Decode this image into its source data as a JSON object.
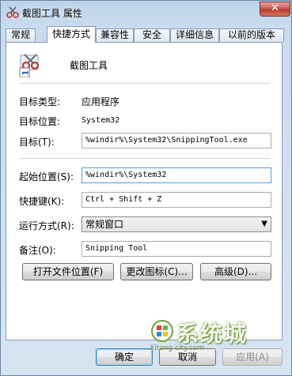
{
  "window": {
    "title": "截图工具 属性",
    "close_glyph": "✕"
  },
  "tabs": [
    "常规",
    "快捷方式",
    "兼容性",
    "安全",
    "详细信息",
    "以前的版本"
  ],
  "active_tab": "快捷方式",
  "app": {
    "name": "截图工具",
    "icon": "scissors-icon"
  },
  "fields": {
    "target_type": {
      "label": "目标类型:",
      "value": "应用程序"
    },
    "target_location": {
      "label": "目标位置:",
      "value": "System32"
    },
    "target": {
      "label": "目标(T):",
      "value": "%windir%\\System32\\SnippingTool.exe"
    },
    "start_in": {
      "label": "起始位置(S):",
      "value": "%windir%\\System32"
    },
    "shortcut_key": {
      "label": "快捷键(K):",
      "value": "Ctrl + Shift + Z"
    },
    "run": {
      "label": "运行方式(R):",
      "value": "常规窗口"
    },
    "comment": {
      "label": "备注(O):",
      "value": "Snipping Tool"
    }
  },
  "buttons": {
    "open_file_location": "打开文件位置(F)",
    "change_icon": "更改图标(C)...",
    "advanced": "高级(D)...",
    "ok": "确定",
    "cancel": "取消",
    "apply": "应用(A)"
  },
  "watermark": {
    "text": "系统城",
    "sub": "Xitong city.com"
  }
}
